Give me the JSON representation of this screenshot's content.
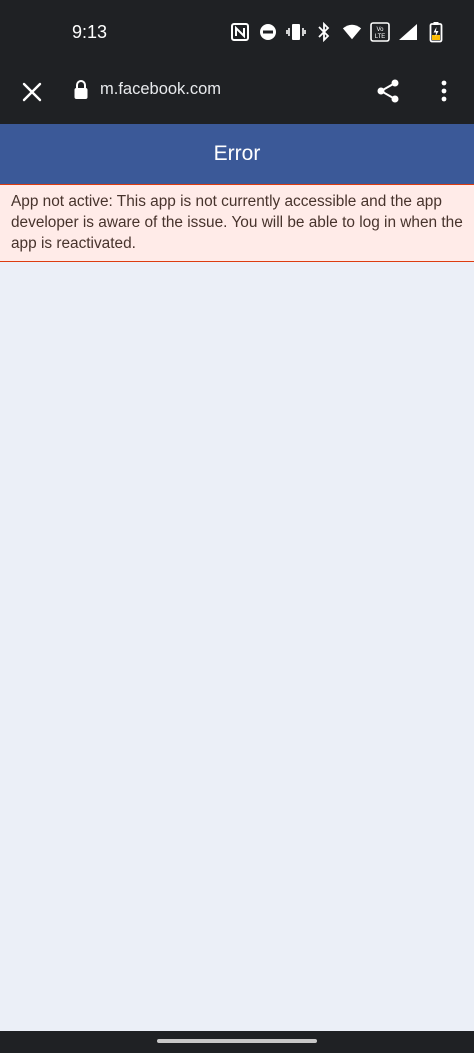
{
  "status_bar": {
    "time": "9:13",
    "icons": [
      "nfc-icon",
      "do-not-disturb-icon",
      "vibrate-icon",
      "bluetooth-icon",
      "wifi-icon",
      "volte-icon",
      "cell-signal-icon",
      "battery-charging-icon"
    ],
    "volte_label": "Vo LTE"
  },
  "toolbar": {
    "url": "m.facebook.com",
    "close_icon": "close-icon",
    "lock_icon": "lock-icon",
    "share_icon": "share-icon",
    "menu_icon": "more-vert-icon"
  },
  "page": {
    "title": "Error",
    "error_message": "App not active: This app is not currently accessible and the app developer is aware of the issue. You will be able to log in when the app is reactivated."
  },
  "colors": {
    "header_bg": "#3b5998",
    "error_bg": "#ffebe8",
    "error_border": "#dd3c10",
    "page_bg": "#ebeff7",
    "chrome_bg": "#1f2124"
  }
}
